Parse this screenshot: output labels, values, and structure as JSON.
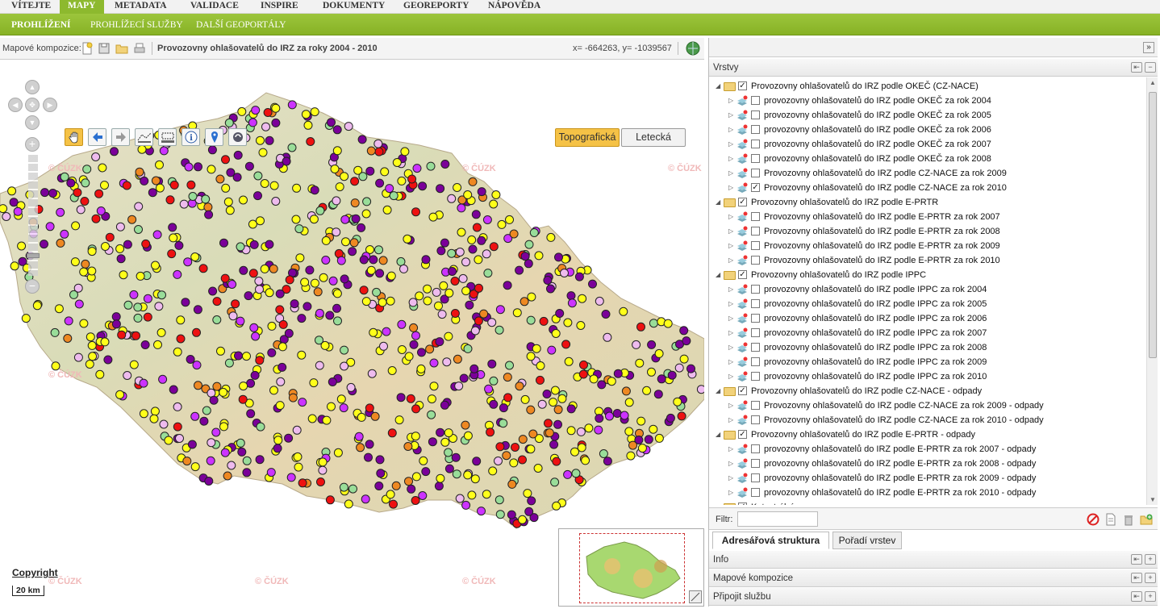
{
  "topnav": [
    {
      "label": "VÍTEJTE",
      "active": false
    },
    {
      "label": "MAPY",
      "active": true
    },
    {
      "label": "METADATA",
      "active": false
    },
    {
      "label": "VALIDACE",
      "active": false
    },
    {
      "label": "INSPIRE",
      "active": false
    },
    {
      "label": "DOKUMENTY",
      "active": false
    },
    {
      "label": "GEOREPORTY",
      "active": false
    },
    {
      "label": "NÁPOVĚDA",
      "active": false
    }
  ],
  "subnav": [
    {
      "label": "PROHLÍŽENÍ",
      "active": true
    },
    {
      "label": "PROHLÍŽECÍ SLUŽBY",
      "active": false
    },
    {
      "label": "DALŠÍ GEOPORTÁLY",
      "active": false
    }
  ],
  "maptoolbar": {
    "compositions_label": "Mapové kompozice:",
    "title": "Provozovny ohlašovatelů do IRZ za roky 2004 - 2010",
    "coords": "x= -664263, y= -1039567"
  },
  "map": {
    "base_topo": "Topografická",
    "base_aerial": "Letecká",
    "copyright": "Copyright",
    "scale": "20 km",
    "watermark": "© ČÚZK",
    "colors": {
      "yellow": "#ffff1a",
      "purple": "#7b0099",
      "violet": "#cc33ff",
      "pink": "#eebbee",
      "red": "#ee1111",
      "orange": "#ee8822",
      "green": "#99dd99"
    }
  },
  "panel": {
    "layers_title": "Vrstvy",
    "filter_label": "Filtr:",
    "tabs": [
      "Adresářová struktura",
      "Pořadí vrstev"
    ],
    "sections": [
      "Info",
      "Mapové kompozice",
      "Připojit službu"
    ]
  },
  "tree": [
    {
      "level": 0,
      "label": "Provozovny ohlašovatelů do IRZ podle OKEČ (CZ-NACE)",
      "checked": true
    },
    {
      "level": 1,
      "label": "provozovny ohlašovatelů do IRZ podle OKEČ za rok 2004",
      "checked": false
    },
    {
      "level": 1,
      "label": "provozovny ohlašovatelů do IRZ podle OKEČ za rok 2005",
      "checked": false
    },
    {
      "level": 1,
      "label": "provozovny ohlašovatelů do IRZ podle OKEČ za rok 2006",
      "checked": false
    },
    {
      "level": 1,
      "label": "provozovny ohlašovatelů do IRZ podle OKEČ za rok 2007",
      "checked": false
    },
    {
      "level": 1,
      "label": "provozovny ohlašovatelů do IRZ podle OKEČ za rok 2008",
      "checked": false
    },
    {
      "level": 1,
      "label": "Provozovny ohlašovatelů do IRZ podle CZ-NACE za rok 2009",
      "checked": false
    },
    {
      "level": 1,
      "label": "Provozovny ohlašovatelů do IRZ podle CZ-NACE za rok 2010",
      "checked": true
    },
    {
      "level": 0,
      "label": "Provozovny ohlašovatelů do IRZ podle E-PRTR",
      "checked": true
    },
    {
      "level": 1,
      "label": "Provozovny ohlašovatelů do IRZ podle E-PRTR za rok 2007",
      "checked": false
    },
    {
      "level": 1,
      "label": "Provozovny ohlašovatelů do IRZ podle E-PRTR za rok 2008",
      "checked": false
    },
    {
      "level": 1,
      "label": "Provozovny ohlašovatelů do IRZ podle E-PRTR za rok 2009",
      "checked": false
    },
    {
      "level": 1,
      "label": "Provozovny ohlašovatelů do IRZ podle E-PRTR za rok 2010",
      "checked": false
    },
    {
      "level": 0,
      "label": "Provozovny ohlašovatelů do IRZ podle IPPC",
      "checked": true
    },
    {
      "level": 1,
      "label": "provozovny ohlašovatelů do IRZ podle IPPC za rok 2004",
      "checked": false
    },
    {
      "level": 1,
      "label": "provozovny ohlašovatelů do IRZ podle IPPC za rok 2005",
      "checked": false
    },
    {
      "level": 1,
      "label": "provozovny ohlašovatelů do IRZ podle IPPC za rok 2006",
      "checked": false
    },
    {
      "level": 1,
      "label": "provozovny ohlašovatelů do IRZ podle IPPC za rok 2007",
      "checked": false
    },
    {
      "level": 1,
      "label": "provozovny ohlašovatelů do IRZ podle IPPC za rok 2008",
      "checked": false
    },
    {
      "level": 1,
      "label": "provozovny ohlašovatelů do IRZ podle IPPC za rok 2009",
      "checked": false
    },
    {
      "level": 1,
      "label": "provozovny ohlašovatelů do IRZ podle IPPC za rok 2010",
      "checked": false
    },
    {
      "level": 0,
      "label": "Provozovny ohlašovatelů do IRZ podle CZ-NACE - odpady",
      "checked": true
    },
    {
      "level": 1,
      "label": "Provozovny ohlašovatelů do IRZ podle CZ-NACE za rok 2009 - odpady",
      "checked": false
    },
    {
      "level": 1,
      "label": "Provozovny ohlašovatelů do IRZ podle CZ-NACE za rok 2010 - odpady",
      "checked": false
    },
    {
      "level": 0,
      "label": "Provozovny ohlašovatelů do IRZ podle E-PRTR - odpady",
      "checked": true
    },
    {
      "level": 1,
      "label": "provozovny ohlašovatelů do IRZ podle E-PRTR za rok 2007 - odpady",
      "checked": false
    },
    {
      "level": 1,
      "label": "provozovny ohlašovatelů do IRZ podle E-PRTR za rok 2008 - odpady",
      "checked": false
    },
    {
      "level": 1,
      "label": "provozovny ohlašovatelů do IRZ podle E-PRTR za rok 2009 - odpady",
      "checked": false
    },
    {
      "level": 1,
      "label": "provozovny ohlašovatelů do IRZ podle E-PRTR za rok 2010 - odpady",
      "checked": false
    },
    {
      "level": 0,
      "label": "Katastrální mapy",
      "checked": true
    }
  ]
}
